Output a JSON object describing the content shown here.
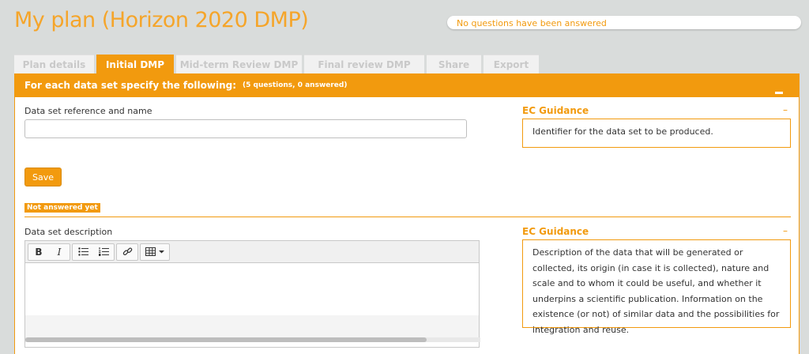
{
  "page": {
    "title": "My plan (Horizon 2020 DMP)",
    "progress_text": "No questions have been answered"
  },
  "tabs": [
    {
      "label": "Plan details",
      "active": false
    },
    {
      "label": "Initial DMP",
      "active": true
    },
    {
      "label": "Mid-term Review DMP",
      "active": false
    },
    {
      "label": "Final review DMP",
      "active": false
    },
    {
      "label": "Share",
      "active": false
    },
    {
      "label": "Export",
      "active": false
    }
  ],
  "section": {
    "title": "For each data set specify the following:",
    "subtitle": "(5 questions, 0 answered)"
  },
  "questions": [
    {
      "label": "Data set reference and name",
      "input_value": "",
      "save_label": "Save",
      "status": "Not answered yet",
      "guidance_title": "EC Guidance",
      "guidance_toggle": "–",
      "guidance_text": "Identifier for the data set to be produced."
    },
    {
      "label": "Data set description",
      "guidance_title": "EC Guidance",
      "guidance_toggle": "–",
      "guidance_text": "Description of the data that will be generated or collected, its origin (in case it is collected), nature and scale and to whom it could be useful, and whether it underpins a scientific publication. Information on the existence (or not) of similar data and the possibilities for integration and reuse."
    }
  ],
  "editor_toolbar": {
    "bold": "B",
    "italic": "I",
    "icons": [
      "bullet-list-icon",
      "numbered-list-icon",
      "link-icon",
      "table-icon",
      "caret-down-icon"
    ]
  },
  "colors": {
    "accent": "#f29a0e",
    "background": "#d9dcdb",
    "title": "#f5a52a"
  }
}
